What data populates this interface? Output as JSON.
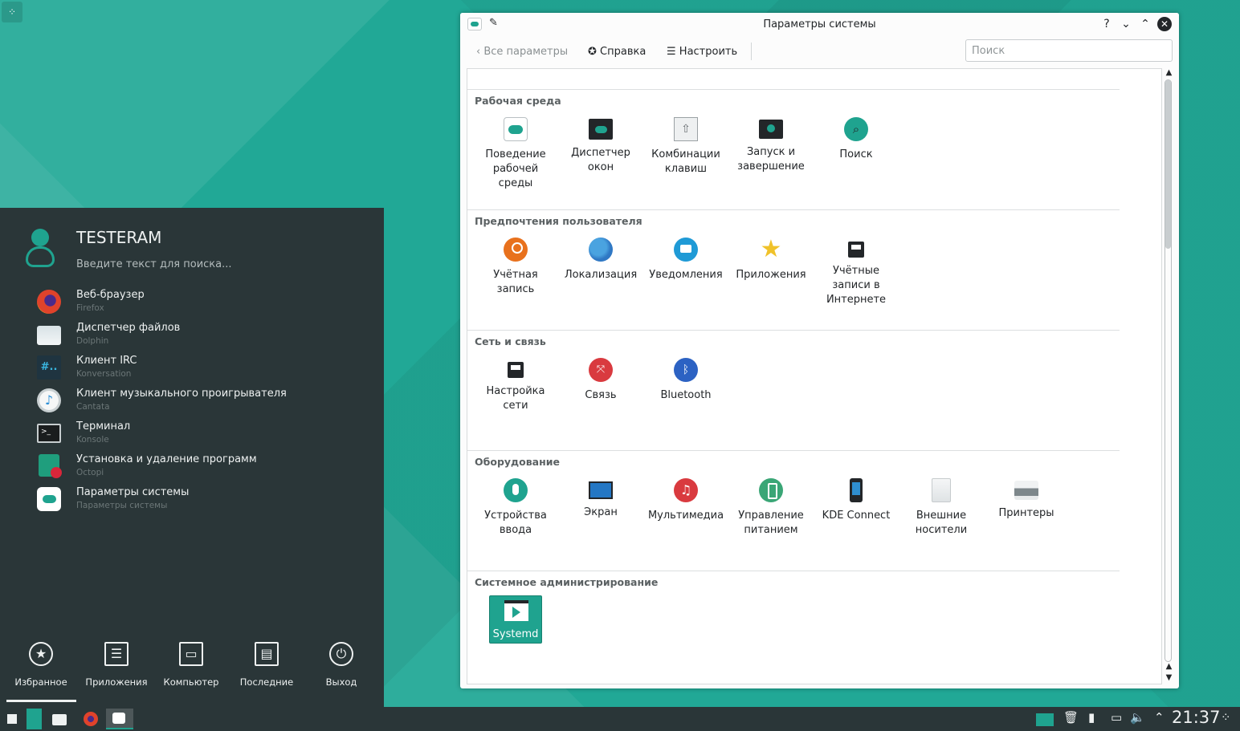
{
  "launcher": {
    "user_name": "TESTERAM",
    "search_hint": "Введите текст для поиска...",
    "favorites": [
      {
        "title": "Веб-браузер",
        "subtitle": "Firefox",
        "icon": "firefox-icon"
      },
      {
        "title": "Диспетчер файлов",
        "subtitle": "Dolphin",
        "icon": "folder-icon"
      },
      {
        "title": "Клиент IRC",
        "subtitle": "Konversation",
        "icon": "irc-icon"
      },
      {
        "title": "Клиент музыкального проигрывателя",
        "subtitle": "Cantata",
        "icon": "music-player-icon"
      },
      {
        "title": "Терминал",
        "subtitle": "Konsole",
        "icon": "terminal-icon"
      },
      {
        "title": "Установка и удаление программ",
        "subtitle": "Octopi",
        "icon": "package-manager-icon"
      },
      {
        "title": "Параметры системы",
        "subtitle": "Параметры системы",
        "icon": "system-settings-icon"
      }
    ],
    "tabs": [
      {
        "label": "Избранное",
        "icon": "★"
      },
      {
        "label": "Приложения",
        "icon": "☰"
      },
      {
        "label": "Компьютер",
        "icon": "▭"
      },
      {
        "label": "Последние",
        "icon": "▤"
      },
      {
        "label": "Выход",
        "icon": "⏻"
      }
    ]
  },
  "window": {
    "title": "Параметры системы",
    "toolbar": {
      "back_label": "Все параметры",
      "help_label": "Справка",
      "configure_label": "Настроить"
    },
    "search_placeholder": "Поиск",
    "groups": [
      {
        "title": "Рабочая среда",
        "modules": [
          {
            "label": "Поведение\nрабочей\nсреды",
            "icon": "toggle-icon"
          },
          {
            "label": "Диспетчер\nокон",
            "icon": "window-manager-icon"
          },
          {
            "label": "Комбинации\nклавиш",
            "icon": "keyboard-shortcut-icon"
          },
          {
            "label": "Запуск и\nзавершение",
            "icon": "startup-icon"
          },
          {
            "label": "Поиск",
            "icon": "search-icon"
          }
        ]
      },
      {
        "title": "Предпочтения пользователя",
        "modules": [
          {
            "label": "Учётная\nзапись",
            "icon": "user-account-icon"
          },
          {
            "label": "Локализация",
            "icon": "globe-icon"
          },
          {
            "label": "Уведомления",
            "icon": "notification-icon"
          },
          {
            "label": "Приложения",
            "icon": "star-icon"
          },
          {
            "label": "Учётные\nзаписи в\nИнтернете",
            "icon": "online-accounts-icon"
          }
        ]
      },
      {
        "title": "Сеть и связь",
        "modules": [
          {
            "label": "Настройка\nсети",
            "icon": "network-icon"
          },
          {
            "label": "Связь",
            "icon": "share-icon"
          },
          {
            "label": "Bluetooth",
            "icon": "bluetooth-icon"
          }
        ]
      },
      {
        "title": "Оборудование",
        "modules": [
          {
            "label": "Устройства\nввода",
            "icon": "mouse-icon"
          },
          {
            "label": "Экран",
            "icon": "display-icon"
          },
          {
            "label": "Мультимедиа",
            "icon": "music-icon"
          },
          {
            "label": "Управление\nпитанием",
            "icon": "battery-icon"
          },
          {
            "label": "KDE Connect",
            "icon": "phone-icon"
          },
          {
            "label": "Внешние\nносители",
            "icon": "drive-icon"
          },
          {
            "label": "Принтеры",
            "icon": "printer-icon"
          }
        ]
      },
      {
        "title": "Системное администрирование",
        "modules": [
          {
            "label": "Systemd",
            "icon": "systemd-icon"
          }
        ]
      }
    ]
  },
  "taskbar": {
    "clock": "21:37"
  },
  "colors": {
    "accent": "#1fa38f",
    "panel": "#2a3638"
  }
}
